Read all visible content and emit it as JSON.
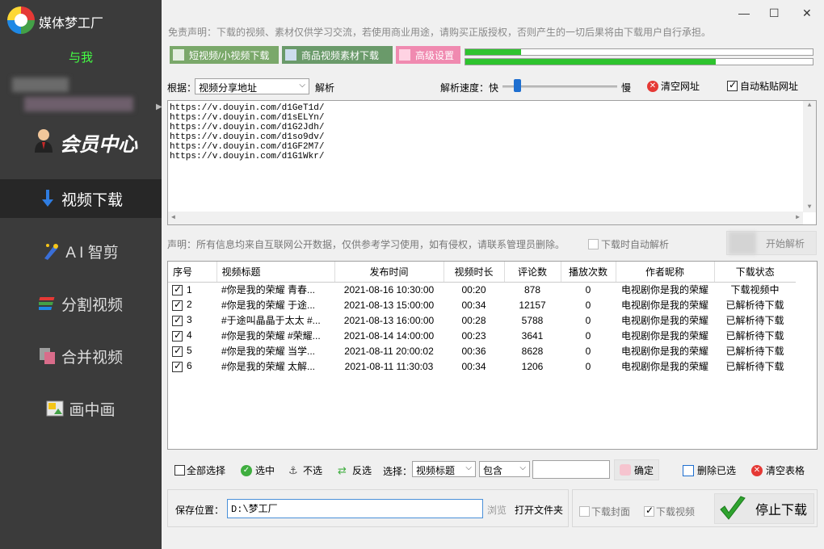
{
  "app": {
    "title": "媒体梦工厂"
  },
  "window": {
    "minimize": "—",
    "maximize": "☐",
    "close": "✕"
  },
  "sidebar": {
    "user_name": "与我",
    "member_center": "会员中心",
    "items": [
      {
        "label": "视频下载",
        "icon": "download-arrow-icon"
      },
      {
        "label": "A I 智剪",
        "icon": "ai-edit-icon"
      },
      {
        "label": "分割视频",
        "icon": "split-video-icon"
      },
      {
        "label": "合并视频",
        "icon": "merge-video-icon"
      },
      {
        "label": "画中画",
        "icon": "picture-in-picture-icon"
      }
    ]
  },
  "disclaimer_top": "免责声明：下载的视频、素材仅供学习交流，若使用商业用途，请购买正版授权，否则产生的一切后果将由下载用户自行承担。",
  "top_buttons": {
    "short_video": "短视频/小视频下载",
    "product_video": "商品视频素材下载",
    "advanced": "高级设置"
  },
  "progress": {
    "bar1": 0.16,
    "bar2": 0.72
  },
  "parse_row": {
    "basis_label": "根据：",
    "basis_value": "视频分享地址",
    "parse_label": "解析",
    "speed_label": "解析速度：快",
    "speed_slow": "慢",
    "speed_value": 0.1,
    "clear_url": "清空网址",
    "auto_paste": "自动粘贴网址"
  },
  "urls": [
    "https://v.douyin.com/d1GeT1d/",
    "https://v.douyin.com/d1sELYn/",
    "https://v.douyin.com/d1G2Jdh/",
    "https://v.douyin.com/d1so9dv/",
    "https://v.douyin.com/d1GF2M7/",
    "https://v.douyin.com/d1G1Wkr/"
  ],
  "statement": "声明：所有信息均来自互联网公开数据，仅供参考学习使用，如有侵权，请联系管理员删除。",
  "auto_parse_on_download": "下载时自动解析",
  "start_parse": "开始解析",
  "table": {
    "headers": [
      "序号",
      "视频标题",
      "发布时间",
      "视频时长",
      "评论数",
      "播放次数",
      "作者昵称",
      "下载状态"
    ],
    "rows": [
      {
        "checked": true,
        "no": "1",
        "title": "#你是我的荣耀 青春...",
        "time": "2021-08-16 10:30:00",
        "duration": "00:20",
        "comments": "878",
        "plays": "0",
        "author": "电视剧你是我的荣耀",
        "status": "下载视频中"
      },
      {
        "checked": true,
        "no": "2",
        "title": "#你是我的荣耀 于途...",
        "time": "2021-08-13 15:00:00",
        "duration": "00:34",
        "comments": "12157",
        "plays": "0",
        "author": "电视剧你是我的荣耀",
        "status": "已解析待下载"
      },
      {
        "checked": true,
        "no": "3",
        "title": "#于途叫晶晶于太太 #...",
        "time": "2021-08-13 16:00:00",
        "duration": "00:28",
        "comments": "5788",
        "plays": "0",
        "author": "电视剧你是我的荣耀",
        "status": "已解析待下载"
      },
      {
        "checked": true,
        "no": "4",
        "title": "#你是我的荣耀 #荣耀...",
        "time": "2021-08-14 14:00:00",
        "duration": "00:23",
        "comments": "3641",
        "plays": "0",
        "author": "电视剧你是我的荣耀",
        "status": "已解析待下载"
      },
      {
        "checked": true,
        "no": "5",
        "title": "#你是我的荣耀 当学...",
        "time": "2021-08-11 20:00:02",
        "duration": "00:36",
        "comments": "8628",
        "plays": "0",
        "author": "电视剧你是我的荣耀",
        "status": "已解析待下载"
      },
      {
        "checked": true,
        "no": "6",
        "title": "#你是我的荣耀 太解...",
        "time": "2021-08-11 11:30:03",
        "duration": "00:34",
        "comments": "1206",
        "plays": "0",
        "author": "电视剧你是我的荣耀",
        "status": "已解析待下载"
      }
    ]
  },
  "bottom": {
    "select_all": "全部选择",
    "select": "选中",
    "unselect": "不选",
    "invert": "反选",
    "choose_label": "选择：",
    "field_value": "视频标题",
    "match_value": "包含",
    "filter_text": "",
    "confirm": "确定",
    "delete_selected": "删除已选",
    "clear_table": "清空表格"
  },
  "save": {
    "label": "保存位置：",
    "path": "D:\\梦工厂",
    "browse": "浏览",
    "open_folder": "打开文件夹"
  },
  "download": {
    "cover": "下载封面",
    "video": "下载视频",
    "stop": "停止下载"
  }
}
